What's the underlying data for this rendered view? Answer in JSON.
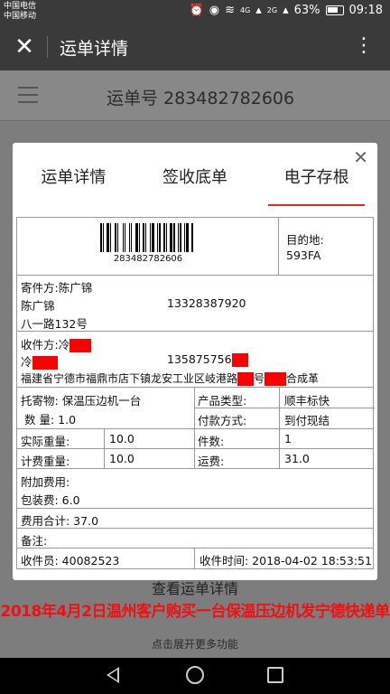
{
  "status_bar": {
    "carrier1": "中国电信",
    "carrier2": "中国移动",
    "network1": "4G",
    "network2": "2G",
    "battery": "63%",
    "time": "09:18"
  },
  "app_bar": {
    "title": "运单详情"
  },
  "background": {
    "waybill_header": "运单号 283482782606",
    "view_detail": "查看运单详情",
    "expand_more": "点击展开更多功能"
  },
  "modal": {
    "tabs": [
      "运单详情",
      "签收底单",
      "电子存根"
    ],
    "active_tab": 2,
    "barcode_number": "283482782606",
    "destination_label": "目的地:",
    "destination_value": "593FA",
    "sender_label": "寄件方:",
    "sender_name": "陈广锦",
    "sender_contact_name": "陈广锦",
    "sender_phone": "13328387920",
    "sender_address": "八一路132号",
    "receiver_label": "收件方:",
    "receiver_name_prefix": "冷",
    "receiver_contact_prefix": "冷",
    "receiver_phone_prefix": "135875756",
    "receiver_address_part1": "福建省宁德市福鼎市店下镇龙安工业区岐港路",
    "receiver_address_part2": "号",
    "receiver_address_part3": "合成革",
    "goods_label": "托寄物:",
    "goods_value": "保温压边机一台",
    "qty_label": "数  量:",
    "qty_value": "1.0",
    "product_type_label": "产品类型:",
    "product_type_value": "顺丰标快",
    "payment_label": "付款方式:",
    "payment_value": "到付现结",
    "actual_weight_label": "实际重量:",
    "actual_weight_value": "10.0",
    "pieces_label": "件数:",
    "pieces_value": "1",
    "billing_weight_label": "计费重量:",
    "billing_weight_value": "10.0",
    "freight_label": "运费:",
    "freight_value": "31.0",
    "extra_fee_label": "附加费用:",
    "packing_fee": "包装费: 6.0",
    "total_fee": "费用合计: 37.0",
    "remark_label": "备注:",
    "courier": "收件员: 40082523",
    "pickup_time": "收件时间: 2018-04-02 18:53:51"
  },
  "banner": "2018年4月2日温州客户购买一台保温压边机发宁德快递单"
}
